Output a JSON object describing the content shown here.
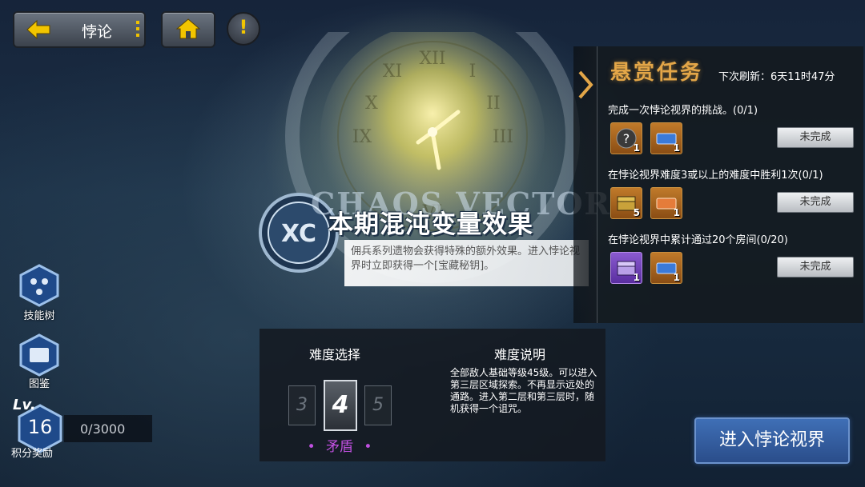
{
  "header": {
    "back_label": "悖论",
    "icons": [
      "back-arrow-icon",
      "home-icon",
      "alert-icon"
    ],
    "alert_glyph": "!"
  },
  "chaos_vector": {
    "emblem_text": "XC",
    "english_title": "CHAOS VECTOR",
    "title": "本期混沌变量效果",
    "description": "佣兵系列遗物会获得特殊的额外效果。进入悖论视界时立即获得一个[宝藏秘钥]。"
  },
  "bounty": {
    "title": "悬赏任务",
    "refresh": "下次刷新：6天11时47分",
    "tasks": [
      {
        "text": "完成一次悖论视界的挑战。(0/1)",
        "status": "未完成",
        "rewards": [
          {
            "icon": "mystery-item-icon",
            "count": "1"
          },
          {
            "icon": "ticket-icon",
            "count": "1"
          }
        ]
      },
      {
        "text": "在悖论视界难度3或以上的难度中胜利1次(0/1)",
        "status": "未完成",
        "rewards": [
          {
            "icon": "treasure-chest-icon",
            "count": "5"
          },
          {
            "icon": "orange-ticket-icon",
            "count": "1"
          }
        ]
      },
      {
        "text": "在悖论视界中累计通过20个房间(0/20)",
        "status": "未完成",
        "rewards": [
          {
            "icon": "purple-chest-icon",
            "count": "1"
          },
          {
            "icon": "ticket-icon",
            "count": "1"
          }
        ]
      }
    ]
  },
  "sidebar": {
    "skill_tree": "技能树",
    "codex": "图鉴",
    "level_prefix": "Lv.",
    "level": "16",
    "points": "0/3000",
    "points_label": "积分奖励"
  },
  "difficulty": {
    "select_title": "难度选择",
    "desc_title": "难度说明",
    "prev": "3",
    "current": "4",
    "next": "5",
    "name": "矛盾",
    "name_dot": "•",
    "description": "全部敌人基础等级45级。可以进入第三层区域探索。不再显示远处的通路。进入第二层和第三层时，随机获得一个诅咒。"
  },
  "enter_button": "进入悖论视界",
  "colors": {
    "accent_gold": "#e3a648",
    "difficulty_purple": "#c050e0",
    "enter_blue": "#2a4d8a"
  }
}
